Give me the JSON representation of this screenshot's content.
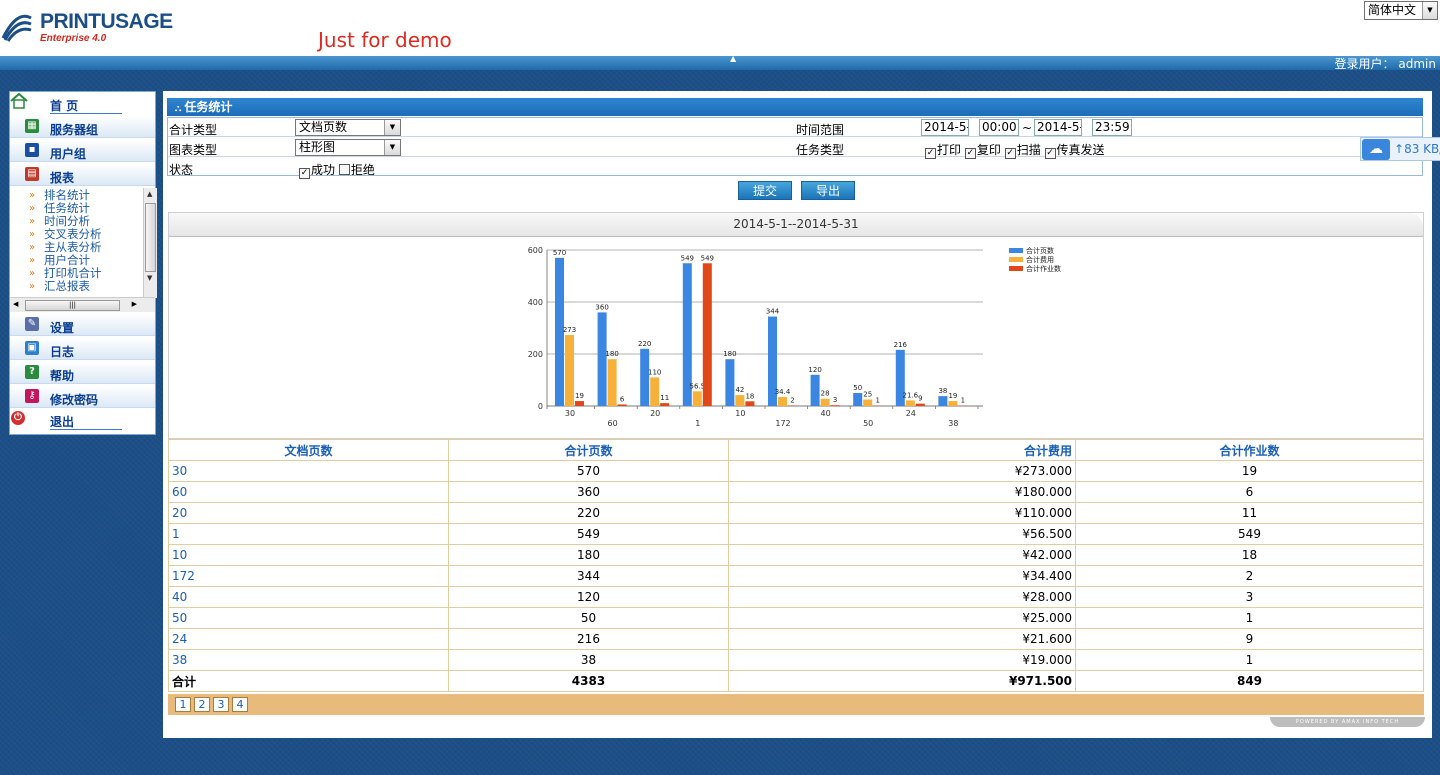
{
  "header": {
    "logo_title": "PRINTUSAGE",
    "logo_sub": "Enterprise 4.0",
    "demo_text": "Just for demo",
    "language": "简体中文",
    "login_label": "登录用户：",
    "login_user": "admin"
  },
  "sidebar": {
    "items": [
      {
        "label": "首 页",
        "icon": "home-icon"
      },
      {
        "label": "服务器组",
        "icon": "server-group-icon"
      },
      {
        "label": "用户组",
        "icon": "user-group-icon"
      },
      {
        "label": "报表",
        "icon": "report-icon"
      },
      {
        "label": "设置",
        "icon": "settings-icon"
      },
      {
        "label": "日志",
        "icon": "log-icon"
      },
      {
        "label": "帮助",
        "icon": "help-icon"
      },
      {
        "label": "修改密码",
        "icon": "key-icon"
      },
      {
        "label": "退出",
        "icon": "power-icon"
      }
    ],
    "report_sub": [
      "排名统计",
      "任务统计",
      "时间分析",
      "交叉表分析",
      "主从表分析",
      "用户合计",
      "打印机合计",
      "汇总报表"
    ]
  },
  "panel": {
    "title": "任务统计",
    "sum_type_label": "合计类型",
    "sum_type_value": "文档页数",
    "chart_type_label": "图表类型",
    "chart_type_value": "柱形图",
    "status_label": "状态",
    "status_success": "成功",
    "status_reject": "拒绝",
    "time_range_label": "时间范围",
    "date_from": "2014-5-",
    "time_from": "00:00:",
    "tilde": "~",
    "date_to": "2014-5-",
    "time_to": "23:59:",
    "task_type_label": "任务类型",
    "task_print": "打印",
    "task_copy": "复印",
    "task_scan": "扫描",
    "task_fax": "传真发送",
    "submit": "提交",
    "export": "导出"
  },
  "float_widget": {
    "speed": "83 KB/"
  },
  "chart_title": "2014-5-1--2014-5-31",
  "chart_data": {
    "type": "bar",
    "categories": [
      "30",
      "60",
      "20",
      "1",
      "10",
      "172",
      "40",
      "50",
      "24",
      "38"
    ],
    "series": [
      {
        "name": "合计页数",
        "color": "#3a86e0",
        "values": [
          570,
          360,
          220,
          549,
          180,
          344,
          120,
          50,
          216,
          38
        ]
      },
      {
        "name": "合计费用",
        "color": "#f7b13b",
        "values": [
          273,
          180,
          110,
          56.5,
          42,
          34.4,
          28,
          25,
          21.6,
          19
        ]
      },
      {
        "name": "合计作业数",
        "color": "#e0481a",
        "values": [
          19,
          6,
          11,
          549,
          18,
          2,
          3,
          1,
          9,
          1
        ]
      }
    ],
    "ylim": [
      0,
      600
    ],
    "yticks": [
      0,
      200,
      400,
      600
    ],
    "grid": true,
    "legend": "top-right"
  },
  "table": {
    "headers": [
      "文档页数",
      "合计页数",
      "合计费用",
      "合计作业数"
    ],
    "rows": [
      [
        "30",
        "570",
        "¥273.000",
        "19"
      ],
      [
        "60",
        "360",
        "¥180.000",
        "6"
      ],
      [
        "20",
        "220",
        "¥110.000",
        "11"
      ],
      [
        "1",
        "549",
        "¥56.500",
        "549"
      ],
      [
        "10",
        "180",
        "¥42.000",
        "18"
      ],
      [
        "172",
        "344",
        "¥34.400",
        "2"
      ],
      [
        "40",
        "120",
        "¥28.000",
        "3"
      ],
      [
        "50",
        "50",
        "¥25.000",
        "1"
      ],
      [
        "24",
        "216",
        "¥21.600",
        "9"
      ],
      [
        "38",
        "38",
        "¥19.000",
        "1"
      ]
    ],
    "total": [
      "合计",
      "4383",
      "¥971.500",
      "849"
    ]
  },
  "pager": [
    "1",
    "2",
    "3",
    "4"
  ],
  "powered": "POWERED BY AMAX INFO TECH"
}
